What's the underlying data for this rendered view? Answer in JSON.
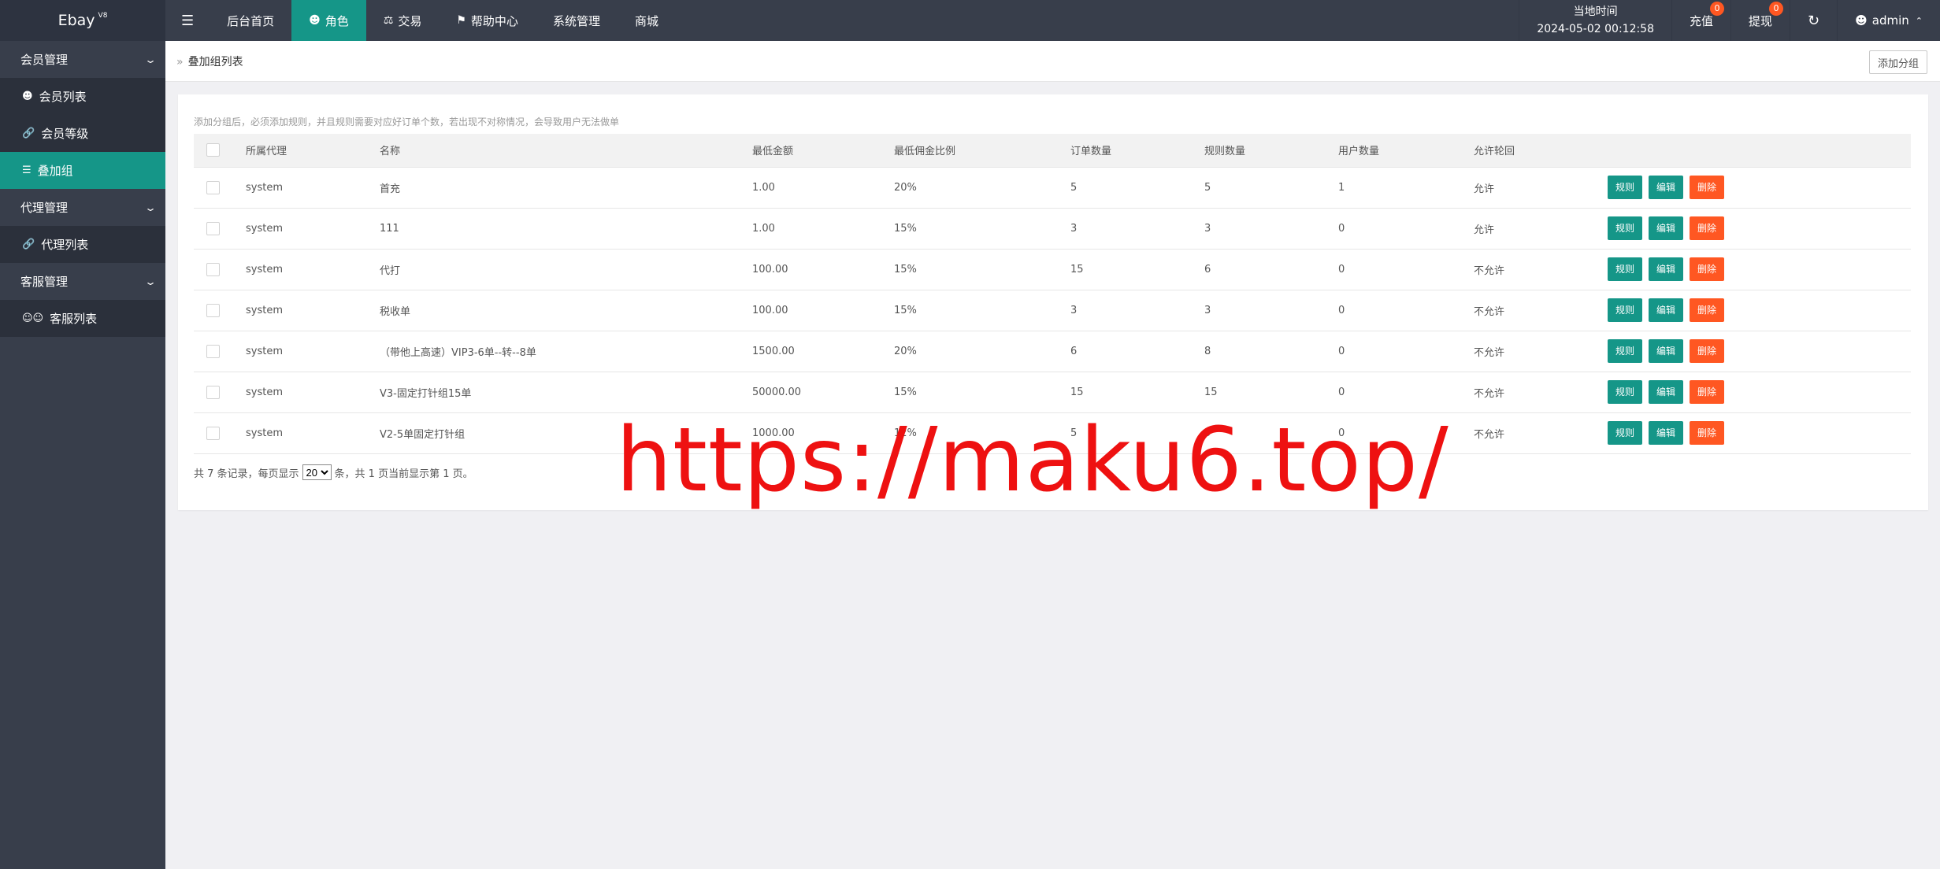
{
  "app": {
    "name": "Ebay",
    "version": "V8"
  },
  "topnav": [
    {
      "label": "后台首页",
      "icon": "",
      "active": false
    },
    {
      "label": "角色",
      "icon": "user-icon",
      "active": true
    },
    {
      "label": "交易",
      "icon": "scale-icon",
      "active": false
    },
    {
      "label": "帮助中心",
      "icon": "flag-icon",
      "active": false
    },
    {
      "label": "系统管理",
      "icon": "",
      "active": false
    },
    {
      "label": "商城",
      "icon": "",
      "active": false
    }
  ],
  "header": {
    "time_label": "当地时间",
    "time_value": "2024-05-02 00:12:58",
    "recharge_label": "充值",
    "recharge_count": "0",
    "withdraw_label": "提现",
    "withdraw_count": "0",
    "user": "admin"
  },
  "sidebar": {
    "groups": [
      {
        "label": "会员管理",
        "items": [
          {
            "label": "会员列表",
            "icon": "user-icon",
            "active": false
          },
          {
            "label": "会员等级",
            "icon": "link-icon",
            "active": false
          },
          {
            "label": "叠加组",
            "icon": "list-icon",
            "active": true
          }
        ]
      },
      {
        "label": "代理管理",
        "items": [
          {
            "label": "代理列表",
            "icon": "link-icon",
            "active": false
          }
        ]
      },
      {
        "label": "客服管理",
        "items": [
          {
            "label": "客服列表",
            "icon": "users-icon",
            "active": false
          }
        ]
      }
    ]
  },
  "page": {
    "breadcrumb": "叠加组列表",
    "add_button": "添加分组",
    "tip": "添加分组后，必须添加规则，并且规则需要对应好订单个数，若出现不对称情况，会导致用户无法做单"
  },
  "table": {
    "columns": [
      "所属代理",
      "名称",
      "最低金额",
      "最低佣金比例",
      "订单数量",
      "规则数量",
      "用户数量",
      "允许轮回"
    ],
    "rows": [
      [
        "system",
        "首充",
        "1.00",
        "20%",
        "5",
        "5",
        "1",
        "允许"
      ],
      [
        "system",
        "111",
        "1.00",
        "15%",
        "3",
        "3",
        "0",
        "允许"
      ],
      [
        "system",
        "代打",
        "100.00",
        "15%",
        "15",
        "6",
        "0",
        "不允许"
      ],
      [
        "system",
        "税收单",
        "100.00",
        "15%",
        "3",
        "3",
        "0",
        "不允许"
      ],
      [
        "system",
        "（带他上高速）VIP3-6单--转--8单",
        "1500.00",
        "20%",
        "6",
        "8",
        "0",
        "不允许"
      ],
      [
        "system",
        "V3-固定打针组15单",
        "50000.00",
        "15%",
        "15",
        "15",
        "0",
        "不允许"
      ],
      [
        "system",
        "V2-5单固定打针组",
        "1000.00",
        "12%",
        "5",
        "5",
        "0",
        "不允许"
      ]
    ],
    "actions": [
      "规则",
      "编辑",
      "删除"
    ]
  },
  "pager": {
    "prefix": "共 7 条记录，每页显示",
    "page_size": "20",
    "suffix": "条，共 1 页当前显示第 1 页。"
  },
  "watermark": "https://maku6.top/",
  "colors": {
    "accent": "#159688",
    "danger": "#ff5722",
    "sidebar": "#383e4b",
    "watermark": "#ee1111"
  }
}
